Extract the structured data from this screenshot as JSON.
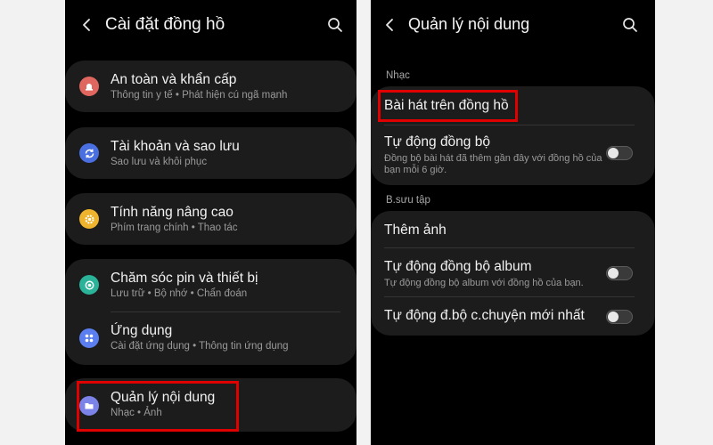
{
  "left": {
    "header": {
      "title": "Cài đặt đồng hồ"
    },
    "items": [
      {
        "title": "An toàn và khẩn cấp",
        "subtitle": "Thông tin y tế • Phát hiện cú ngã mạnh",
        "icon": "siren-icon",
        "icon_color": "#e0675f"
      },
      {
        "title": "Tài khoản và sao lưu",
        "subtitle": "Sao lưu và khôi phục",
        "icon": "sync-icon",
        "icon_color": "#4a6fe0"
      },
      {
        "title": "Tính năng nâng cao",
        "subtitle": "Phím trang chính • Thao tác",
        "icon": "gear-plus-icon",
        "icon_color": "#efb42d"
      },
      {
        "title": "Chăm sóc pin và thiết bị",
        "subtitle": "Lưu trữ • Bộ nhớ • Chẩn đoán",
        "icon": "device-care-icon",
        "icon_color": "#2bb39a"
      },
      {
        "title": "Ứng dụng",
        "subtitle": "Cài đặt ứng dụng • Thông tin ứng dụng",
        "icon": "apps-icon",
        "icon_color": "#5b7ff0"
      },
      {
        "title": "Quản lý nội dung",
        "subtitle": "Nhạc • Ảnh",
        "icon": "folder-icon",
        "icon_color": "#7c83e8"
      }
    ]
  },
  "right": {
    "header": {
      "title": "Quản lý nội dung"
    },
    "sections": [
      {
        "label": "Nhạc",
        "items": [
          {
            "title": "Bài hát trên đồng hồ"
          },
          {
            "title": "Tự động đồng bộ",
            "subtitle": "Đồng bộ bài hát đã thêm gần đây với đồng hồ của bạn mỗi 6 giờ.",
            "toggle": false
          }
        ]
      },
      {
        "label": "B.sưu tập",
        "items": [
          {
            "title": "Thêm ảnh"
          },
          {
            "title": "Tự động đồng bộ album",
            "subtitle": "Tự động đồng bộ album với đồng hồ của bạn.",
            "toggle": false
          },
          {
            "title": "Tự động đ.bộ c.chuyện mới nhất",
            "toggle": false
          }
        ]
      }
    ]
  },
  "colors": {
    "highlight": "#e00000",
    "card": "#1c1c1c",
    "background": "#000000"
  }
}
